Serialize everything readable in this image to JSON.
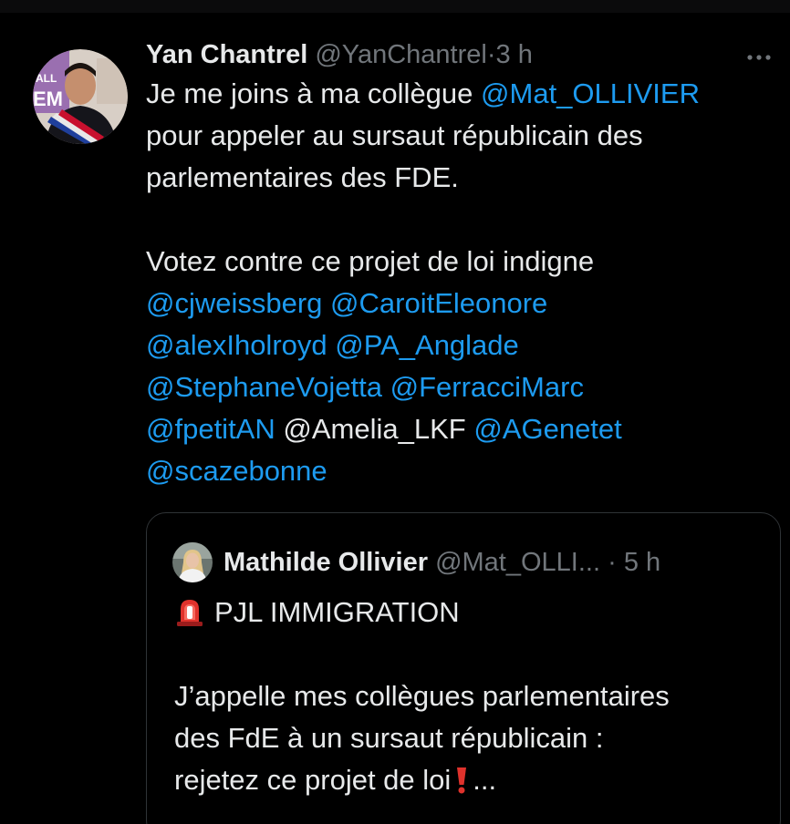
{
  "tweet": {
    "author": {
      "name": "Yan Chantrel",
      "handle": "@YanChantrel",
      "separator": "·",
      "time": "3 h",
      "avatar_icon": "profile-photo-icon"
    },
    "more_icon": "ellipsis-icon",
    "body": {
      "line1_text": "Je me joins à ma collègue ",
      "line1_mention": "@Mat_OLLIVIER",
      "line2": "pour appeler au sursaut républicain des",
      "line3": "parlementaires des FDE.",
      "line4": "Votez contre ce projet de loi indigne",
      "mentions": [
        "@cjweissberg",
        "@CaroitEleonore",
        "@alexIholroyd",
        "@PA_Anglade",
        "@StephaneVojetta",
        "@FerracciMarc",
        "@fpetitAN",
        "@Amelia_LKF",
        "@AGenetet",
        "@scazebonne"
      ]
    }
  },
  "quoted": {
    "author": {
      "name": "Mathilde Ollivier",
      "handle": "@Mat_OLLI...",
      "separator": "·",
      "time": "5 h",
      "avatar_icon": "profile-photo-icon"
    },
    "title_icon": "rotating-light-icon",
    "title": "PJL IMMIGRATION",
    "line1": "J’appelle mes collègues parlementaires",
    "line2": "des FdE à un sursaut républicain :",
    "line3_text": "rejetez ce projet de loi",
    "line3_icon": "exclamation-icon",
    "line3_more": "..."
  },
  "colors": {
    "background": "#000000",
    "text": "#e7e9ea",
    "muted": "#71767b",
    "link": "#1d9bf0",
    "border": "#2f3336"
  }
}
